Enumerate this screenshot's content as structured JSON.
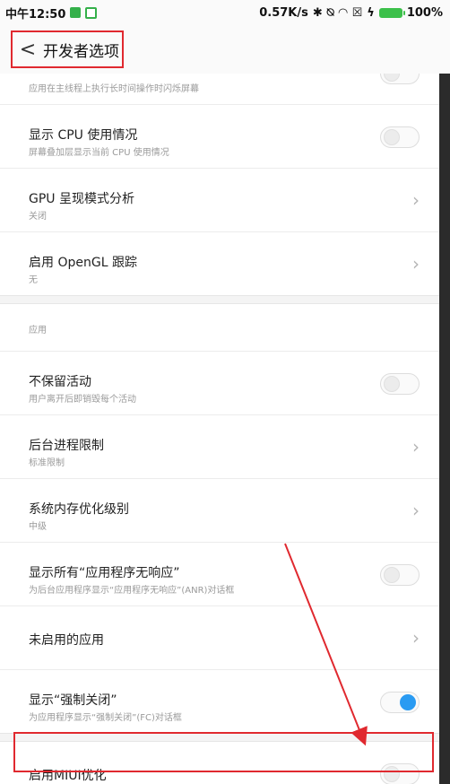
{
  "status_bar": {
    "time": "中午12:50",
    "speed": "0.57K/s",
    "battery": "100%"
  },
  "header": {
    "title": "开发者选项",
    "back_glyph": "<"
  },
  "sections": {
    "top": {
      "items": [
        {
          "title": "",
          "subtitle": "应用在主线程上执行长时间操作时闪烁屏幕",
          "control": "toggle",
          "on": false
        },
        {
          "title": "显示 CPU 使用情况",
          "subtitle": "屏幕叠加层显示当前 CPU 使用情况",
          "control": "toggle",
          "on": false
        },
        {
          "title": "GPU 呈现模式分析",
          "subtitle": "关闭",
          "control": "chevron"
        },
        {
          "title": "启用 OpenGL 跟踪",
          "subtitle": "无",
          "control": "chevron"
        }
      ]
    },
    "apps": {
      "label": "应用",
      "items": [
        {
          "title": "不保留活动",
          "subtitle": "用户离开后即销毁每个活动",
          "control": "toggle",
          "on": false
        },
        {
          "title": "后台进程限制",
          "subtitle": "标准限制",
          "control": "chevron"
        },
        {
          "title": "系统内存优化级别",
          "subtitle": "中级",
          "control": "chevron"
        },
        {
          "title": "显示所有“应用程序无响应”",
          "subtitle": "为后台应用程序显示“应用程序无响应”(ANR)对话框",
          "control": "toggle",
          "on": false
        },
        {
          "title": "未启用的应用",
          "subtitle": "",
          "control": "chevron"
        },
        {
          "title": "显示“强制关闭”",
          "subtitle": "为应用程序显示“强制关闭”(FC)对话框",
          "control": "toggle",
          "on": true
        }
      ]
    },
    "miui": {
      "items": [
        {
          "title": "启用MIUI优化",
          "subtitle": "",
          "control": "toggle",
          "on": false
        }
      ]
    }
  },
  "colors": {
    "accent": "#2a9bf2",
    "annotation": "#e0292f"
  }
}
